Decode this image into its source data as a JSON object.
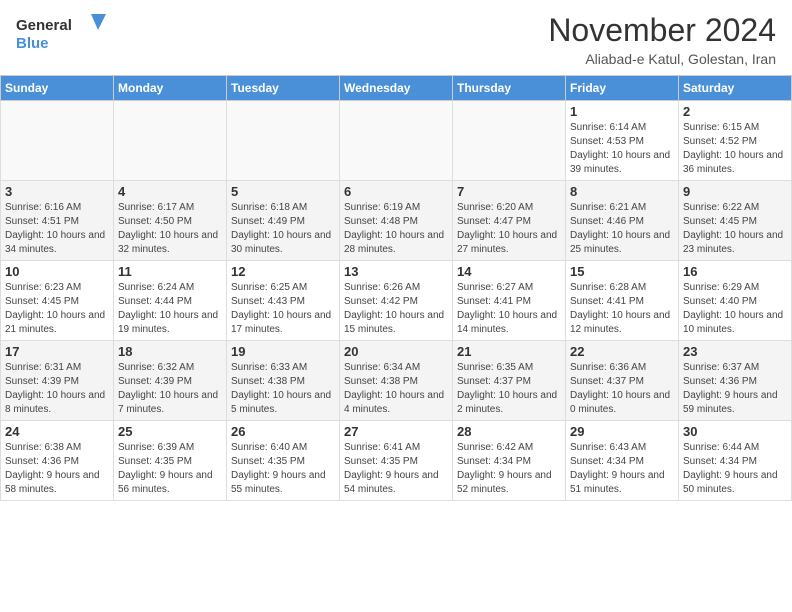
{
  "logo": {
    "general": "General",
    "blue": "Blue"
  },
  "title": "November 2024",
  "location": "Aliabad-e Katul, Golestan, Iran",
  "days_of_week": [
    "Sunday",
    "Monday",
    "Tuesday",
    "Wednesday",
    "Thursday",
    "Friday",
    "Saturday"
  ],
  "weeks": [
    [
      {
        "day": "",
        "info": ""
      },
      {
        "day": "",
        "info": ""
      },
      {
        "day": "",
        "info": ""
      },
      {
        "day": "",
        "info": ""
      },
      {
        "day": "",
        "info": ""
      },
      {
        "day": "1",
        "info": "Sunrise: 6:14 AM\nSunset: 4:53 PM\nDaylight: 10 hours and 39 minutes."
      },
      {
        "day": "2",
        "info": "Sunrise: 6:15 AM\nSunset: 4:52 PM\nDaylight: 10 hours and 36 minutes."
      }
    ],
    [
      {
        "day": "3",
        "info": "Sunrise: 6:16 AM\nSunset: 4:51 PM\nDaylight: 10 hours and 34 minutes."
      },
      {
        "day": "4",
        "info": "Sunrise: 6:17 AM\nSunset: 4:50 PM\nDaylight: 10 hours and 32 minutes."
      },
      {
        "day": "5",
        "info": "Sunrise: 6:18 AM\nSunset: 4:49 PM\nDaylight: 10 hours and 30 minutes."
      },
      {
        "day": "6",
        "info": "Sunrise: 6:19 AM\nSunset: 4:48 PM\nDaylight: 10 hours and 28 minutes."
      },
      {
        "day": "7",
        "info": "Sunrise: 6:20 AM\nSunset: 4:47 PM\nDaylight: 10 hours and 27 minutes."
      },
      {
        "day": "8",
        "info": "Sunrise: 6:21 AM\nSunset: 4:46 PM\nDaylight: 10 hours and 25 minutes."
      },
      {
        "day": "9",
        "info": "Sunrise: 6:22 AM\nSunset: 4:45 PM\nDaylight: 10 hours and 23 minutes."
      }
    ],
    [
      {
        "day": "10",
        "info": "Sunrise: 6:23 AM\nSunset: 4:45 PM\nDaylight: 10 hours and 21 minutes."
      },
      {
        "day": "11",
        "info": "Sunrise: 6:24 AM\nSunset: 4:44 PM\nDaylight: 10 hours and 19 minutes."
      },
      {
        "day": "12",
        "info": "Sunrise: 6:25 AM\nSunset: 4:43 PM\nDaylight: 10 hours and 17 minutes."
      },
      {
        "day": "13",
        "info": "Sunrise: 6:26 AM\nSunset: 4:42 PM\nDaylight: 10 hours and 15 minutes."
      },
      {
        "day": "14",
        "info": "Sunrise: 6:27 AM\nSunset: 4:41 PM\nDaylight: 10 hours and 14 minutes."
      },
      {
        "day": "15",
        "info": "Sunrise: 6:28 AM\nSunset: 4:41 PM\nDaylight: 10 hours and 12 minutes."
      },
      {
        "day": "16",
        "info": "Sunrise: 6:29 AM\nSunset: 4:40 PM\nDaylight: 10 hours and 10 minutes."
      }
    ],
    [
      {
        "day": "17",
        "info": "Sunrise: 6:31 AM\nSunset: 4:39 PM\nDaylight: 10 hours and 8 minutes."
      },
      {
        "day": "18",
        "info": "Sunrise: 6:32 AM\nSunset: 4:39 PM\nDaylight: 10 hours and 7 minutes."
      },
      {
        "day": "19",
        "info": "Sunrise: 6:33 AM\nSunset: 4:38 PM\nDaylight: 10 hours and 5 minutes."
      },
      {
        "day": "20",
        "info": "Sunrise: 6:34 AM\nSunset: 4:38 PM\nDaylight: 10 hours and 4 minutes."
      },
      {
        "day": "21",
        "info": "Sunrise: 6:35 AM\nSunset: 4:37 PM\nDaylight: 10 hours and 2 minutes."
      },
      {
        "day": "22",
        "info": "Sunrise: 6:36 AM\nSunset: 4:37 PM\nDaylight: 10 hours and 0 minutes."
      },
      {
        "day": "23",
        "info": "Sunrise: 6:37 AM\nSunset: 4:36 PM\nDaylight: 9 hours and 59 minutes."
      }
    ],
    [
      {
        "day": "24",
        "info": "Sunrise: 6:38 AM\nSunset: 4:36 PM\nDaylight: 9 hours and 58 minutes."
      },
      {
        "day": "25",
        "info": "Sunrise: 6:39 AM\nSunset: 4:35 PM\nDaylight: 9 hours and 56 minutes."
      },
      {
        "day": "26",
        "info": "Sunrise: 6:40 AM\nSunset: 4:35 PM\nDaylight: 9 hours and 55 minutes."
      },
      {
        "day": "27",
        "info": "Sunrise: 6:41 AM\nSunset: 4:35 PM\nDaylight: 9 hours and 54 minutes."
      },
      {
        "day": "28",
        "info": "Sunrise: 6:42 AM\nSunset: 4:34 PM\nDaylight: 9 hours and 52 minutes."
      },
      {
        "day": "29",
        "info": "Sunrise: 6:43 AM\nSunset: 4:34 PM\nDaylight: 9 hours and 51 minutes."
      },
      {
        "day": "30",
        "info": "Sunrise: 6:44 AM\nSunset: 4:34 PM\nDaylight: 9 hours and 50 minutes."
      }
    ]
  ]
}
